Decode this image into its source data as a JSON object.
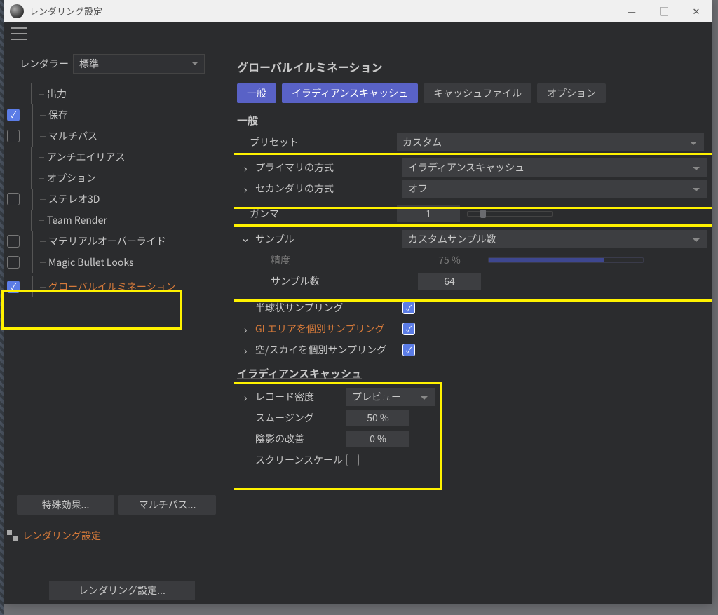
{
  "titlebar": {
    "title": "レンダリング設定"
  },
  "renderer": {
    "label": "レンダラー",
    "selected": "標準"
  },
  "sidebar": {
    "items": [
      {
        "label": "出力",
        "checked": null
      },
      {
        "label": "保存",
        "checked": true
      },
      {
        "label": "マルチパス",
        "checked": false
      },
      {
        "label": "アンチエイリアス",
        "checked": null
      },
      {
        "label": "オプション",
        "checked": null
      },
      {
        "label": "ステレオ3D",
        "checked": false
      },
      {
        "label": "Team Render",
        "checked": null
      },
      {
        "label": "マテリアルオーバーライド",
        "checked": false
      },
      {
        "label": "Magic Bullet Looks",
        "checked": false
      },
      {
        "label": "グローバルイルミネーション",
        "checked": true
      }
    ],
    "effects_btn": "特殊効果...",
    "multipass_btn": "マルチパス...",
    "render_settings": "レンダリング設定",
    "footer_btn": "レンダリング設定..."
  },
  "main": {
    "title": "グローバルイルミネーション",
    "tabs": [
      "一般",
      "イラディアンスキャッシュ",
      "キャッシュファイル",
      "オプション"
    ],
    "general": {
      "title": "一般",
      "preset": {
        "label": "プリセット",
        "value": "カスタム"
      },
      "primary": {
        "label": "プライマリの方式",
        "value": "イラディアンスキャッシュ"
      },
      "secondary": {
        "label": "セカンダリの方式",
        "value": "オフ"
      },
      "gamma": {
        "label": "ガンマ",
        "value": "1"
      },
      "sample": {
        "label": "サンプル",
        "value": "カスタムサンプル数"
      },
      "accuracy": {
        "label": "精度",
        "value": "75 %"
      },
      "sample_count": {
        "label": "サンプル数",
        "value": "64"
      },
      "hemisphere": {
        "label": "半球状サンプリング",
        "checked": true
      },
      "gi_area": {
        "label": "GI エリアを個別サンプリング",
        "checked": true
      },
      "sky": {
        "label": "空/スカイを個別サンプリング",
        "checked": true
      }
    },
    "irradiance": {
      "title": "イラディアンスキャッシュ",
      "record_density": {
        "label": "レコード密度",
        "value": "プレビュー"
      },
      "smoothing": {
        "label": "スムージング",
        "value": "50 %"
      },
      "shading": {
        "label": "陰影の改善",
        "value": "0 %"
      },
      "screen_scale": {
        "label": "スクリーンスケール",
        "checked": false
      }
    }
  }
}
